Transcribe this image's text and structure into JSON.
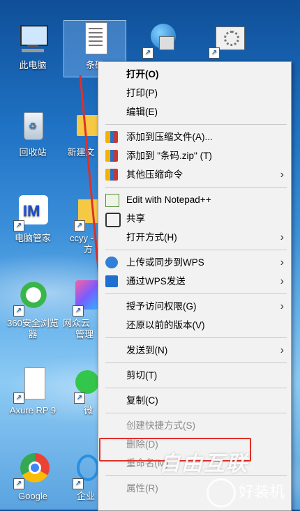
{
  "desktop": {
    "icons": [
      {
        "label": "此电脑",
        "icon": "computer-icon"
      },
      {
        "label": "条码",
        "icon": "document-icon"
      },
      {
        "label": "",
        "icon": "network-globe-icon"
      },
      {
        "label": "",
        "icon": "settings-window-icon"
      },
      {
        "label": "回收站",
        "icon": "recycle-bin-icon"
      },
      {
        "label": "新建文",
        "icon": "folder-icon"
      },
      {
        "label": "电脑管家",
        "icon": "pc-manager-icon"
      },
      {
        "label": "ccyy -",
        "icon": "folder-icon"
      },
      {
        "label": "方",
        "icon": ""
      },
      {
        "label": "360安全浏览",
        "icon": "360-browser-icon"
      },
      {
        "label": "器",
        "icon": ""
      },
      {
        "label": "网众云",
        "icon": "app-icon"
      },
      {
        "label": "管理",
        "icon": ""
      },
      {
        "label": "Axure RP 9",
        "icon": "document-icon"
      },
      {
        "label": "微",
        "icon": "wechat-icon"
      },
      {
        "label": "Google",
        "icon": "chrome-icon"
      },
      {
        "label": "企业",
        "icon": "app-icon"
      }
    ]
  },
  "context_menu": {
    "items": [
      {
        "label": "打开(O)",
        "bold": true
      },
      {
        "label": "打印(P)"
      },
      {
        "label": "编辑(E)"
      },
      {
        "label": "添加到压缩文件(A)...",
        "icon": "archive-icon"
      },
      {
        "label": "添加到 \"条码.zip\" (T)",
        "icon": "archive-icon"
      },
      {
        "label": "其他压缩命令",
        "icon": "archive-icon",
        "submenu": true
      },
      {
        "label": "Edit with Notepad++",
        "icon": "notepad-icon"
      },
      {
        "label": "共享",
        "icon": "share-icon"
      },
      {
        "label": "打开方式(H)",
        "submenu": true
      },
      {
        "label": "上传或同步到WPS",
        "icon": "cloud-upload-icon",
        "submenu": true
      },
      {
        "label": "通过WPS发送",
        "icon": "wps-send-icon",
        "submenu": true
      },
      {
        "label": "授予访问权限(G)",
        "submenu": true
      },
      {
        "label": "还原以前的版本(V)"
      },
      {
        "label": "发送到(N)",
        "submenu": true
      },
      {
        "label": "剪切(T)"
      },
      {
        "label": "复制(C)"
      },
      {
        "label": "创建快捷方式(S)"
      },
      {
        "label": "删除(D)"
      },
      {
        "label": "重命名(M)"
      },
      {
        "label": "属性(R)"
      }
    ]
  },
  "watermark": {
    "line1": "自由互联",
    "line2": "好装机"
  }
}
